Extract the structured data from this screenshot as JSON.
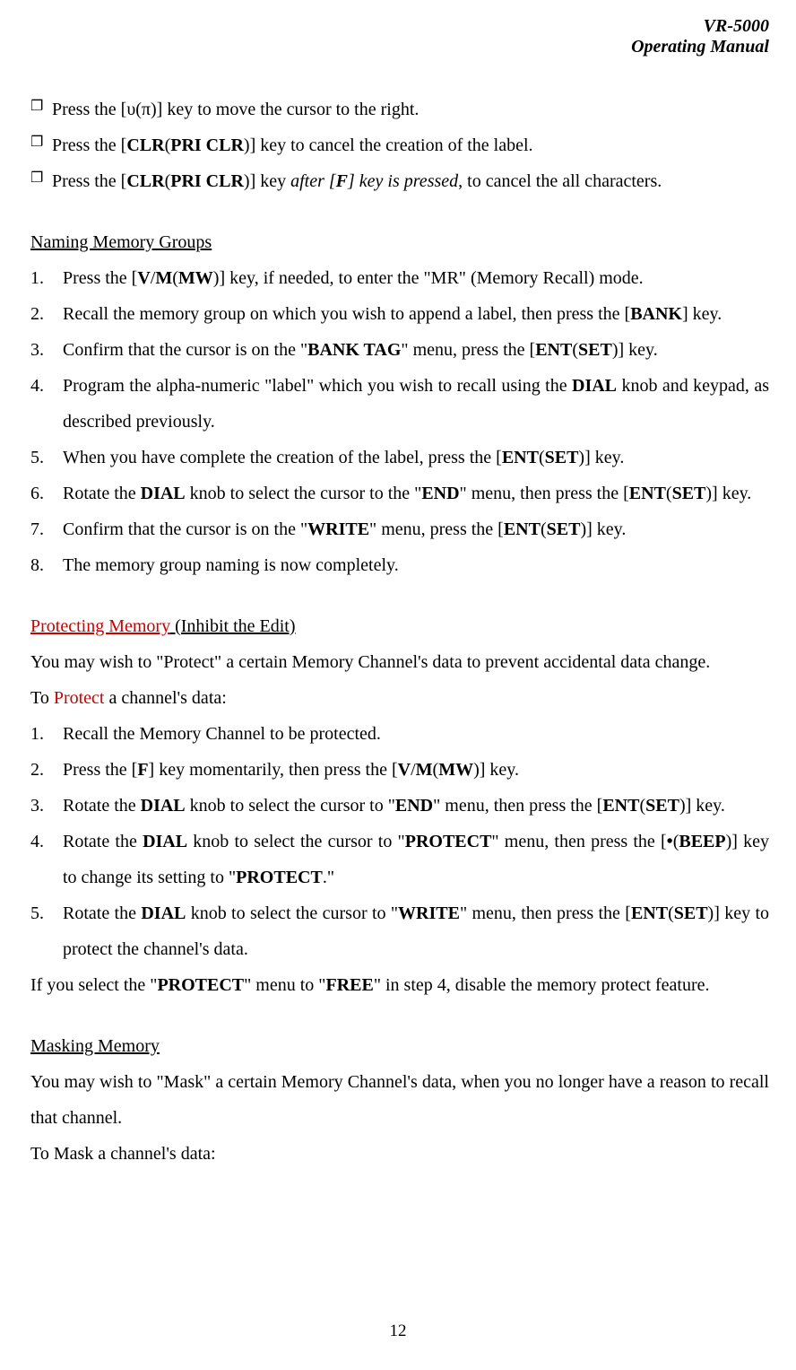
{
  "header": {
    "line1": "VR-5000",
    "line2": "Operating Manual"
  },
  "bullets": [
    {
      "pre": "Press the [",
      "sym": "υ",
      "mid1": "(",
      "sym2": "π",
      "mid2": ")] key to move the cursor to the right."
    },
    {
      "pre": "Press the [",
      "k1": "CLR",
      "mid1": "(",
      "k2": "PRI CLR",
      "post": ")] key to cancel the creation of the label."
    },
    {
      "pre": "Press the [",
      "k1": "CLR",
      "mid1": "(",
      "k2": "PRI CLR",
      "mid2": ")] key ",
      "it1": "after [",
      "itk": "F",
      "it2": "] key is pressed",
      "post": ", to cancel the all characters."
    }
  ],
  "naming": {
    "heading": "Naming Memory Groups",
    "items": [
      {
        "t": [
          {
            "s": "Press the ["
          },
          {
            "s": "V",
            "b": 1
          },
          {
            "s": "/"
          },
          {
            "s": "M",
            "b": 1
          },
          {
            "s": "("
          },
          {
            "s": "MW",
            "b": 1
          },
          {
            "s": ")] key, if needed, to enter the \"MR\" (Memory Recall) mode."
          }
        ]
      },
      {
        "t": [
          {
            "s": "Recall the memory group on which you wish to append a label, then press the ["
          },
          {
            "s": "BANK",
            "b": 1
          },
          {
            "s": "] key."
          }
        ]
      },
      {
        "t": [
          {
            "s": "Confirm that the cursor is on the \""
          },
          {
            "s": "BANK TAG",
            "b": 1
          },
          {
            "s": "\" menu, press the ["
          },
          {
            "s": "ENT",
            "b": 1
          },
          {
            "s": "("
          },
          {
            "s": "SET",
            "b": 1
          },
          {
            "s": ")] key."
          }
        ]
      },
      {
        "t": [
          {
            "s": "Program the alpha-numeric \"label\" which you wish to recall using the "
          },
          {
            "s": "DIAL",
            "b": 1
          },
          {
            "s": " knob and keypad, as described previously."
          }
        ]
      },
      {
        "t": [
          {
            "s": "When you have complete the creation of the label, press the ["
          },
          {
            "s": "ENT",
            "b": 1
          },
          {
            "s": "("
          },
          {
            "s": "SET",
            "b": 1
          },
          {
            "s": ")] key."
          }
        ]
      },
      {
        "t": [
          {
            "s": "Rotate the "
          },
          {
            "s": "DIAL",
            "b": 1
          },
          {
            "s": " knob to select the cursor to the \""
          },
          {
            "s": "END",
            "b": 1
          },
          {
            "s": "\" menu, then press the ["
          },
          {
            "s": "ENT",
            "b": 1
          },
          {
            "s": "("
          },
          {
            "s": "SET",
            "b": 1
          },
          {
            "s": ")] key."
          }
        ]
      },
      {
        "t": [
          {
            "s": "Confirm that the cursor is on the \""
          },
          {
            "s": "WRITE",
            "b": 1
          },
          {
            "s": "\" menu, press the ["
          },
          {
            "s": "ENT",
            "b": 1
          },
          {
            "s": "("
          },
          {
            "s": "SET",
            "b": 1
          },
          {
            "s": ")] key."
          }
        ]
      },
      {
        "t": [
          {
            "s": "The memory group naming is now completely."
          }
        ]
      }
    ]
  },
  "protect": {
    "heading_red": "Protecting Memory",
    "heading_rest": " (Inhibit the Edit)",
    "intro": "You may wish to \"Protect\" a certain Memory Channel's data to prevent accidental data change.",
    "to_pre": "To ",
    "to_red": "Protect",
    "to_post": " a channel's data:",
    "items": [
      {
        "t": [
          {
            "s": "Recall the Memory Channel to be protected."
          }
        ]
      },
      {
        "t": [
          {
            "s": "Press the ["
          },
          {
            "s": "F",
            "b": 1
          },
          {
            "s": "] key momentarily, then press the ["
          },
          {
            "s": "V",
            "b": 1
          },
          {
            "s": "/"
          },
          {
            "s": "M",
            "b": 1
          },
          {
            "s": "("
          },
          {
            "s": "MW",
            "b": 1
          },
          {
            "s": ")] key."
          }
        ]
      },
      {
        "t": [
          {
            "s": "Rotate the "
          },
          {
            "s": "DIAL",
            "b": 1
          },
          {
            "s": " knob to select the cursor to \""
          },
          {
            "s": "END",
            "b": 1
          },
          {
            "s": "\" menu, then press the ["
          },
          {
            "s": "ENT",
            "b": 1
          },
          {
            "s": "("
          },
          {
            "s": "SET",
            "b": 1
          },
          {
            "s": ")] key."
          }
        ]
      },
      {
        "t": [
          {
            "s": "Rotate the "
          },
          {
            "s": "DIAL",
            "b": 1
          },
          {
            "s": " knob to select the cursor to \""
          },
          {
            "s": "PROTECT",
            "b": 1
          },
          {
            "s": "\" menu, then press the ["
          },
          {
            "s": "•",
            "b": 1
          },
          {
            "s": "("
          },
          {
            "s": "BEEP",
            "b": 1
          },
          {
            "s": ")] key to change its setting to \""
          },
          {
            "s": "PROTECT",
            "b": 1
          },
          {
            "s": ".\""
          }
        ]
      },
      {
        "t": [
          {
            "s": "Rotate the "
          },
          {
            "s": "DIAL",
            "b": 1
          },
          {
            "s": " knob to select the cursor to \""
          },
          {
            "s": "WRITE",
            "b": 1
          },
          {
            "s": "\" menu, then press the ["
          },
          {
            "s": "ENT",
            "b": 1
          },
          {
            "s": "("
          },
          {
            "s": "SET",
            "b": 1
          },
          {
            "s": ")] key to protect the channel's data."
          }
        ]
      }
    ],
    "after": [
      {
        "s": "If you select the \""
      },
      {
        "s": "PROTECT",
        "b": 1
      },
      {
        "s": "\" menu to \""
      },
      {
        "s": "FREE",
        "b": 1
      },
      {
        "s": "\" in step 4, disable the memory protect feature."
      }
    ]
  },
  "mask": {
    "heading": "Masking Memory",
    "p1": "You may wish to \"Mask\" a certain Memory Channel's data, when you no longer have a reason to recall that channel.",
    "p2": "To Mask a channel's data:"
  },
  "page_number": "12"
}
